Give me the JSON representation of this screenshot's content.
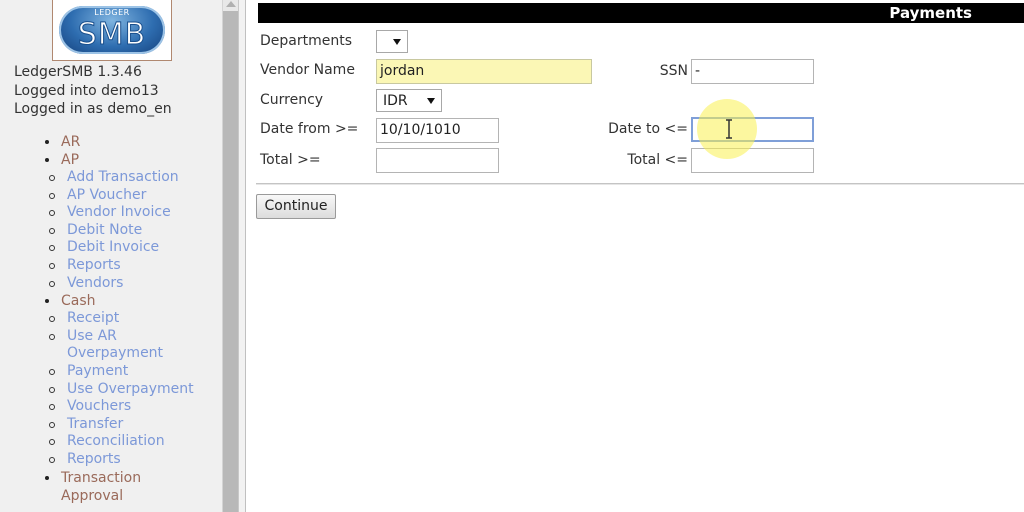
{
  "sidebar": {
    "logo": {
      "top_text": "LEDGER",
      "main_text": "SMB"
    },
    "info": {
      "version": "LedgerSMB 1.3.46",
      "database": "Logged into demo13",
      "user": "Logged in as demo_en"
    },
    "menu": [
      {
        "label": "AR",
        "children": []
      },
      {
        "label": "AP",
        "children": [
          "Add Transaction",
          "AP Voucher",
          "Vendor Invoice",
          "Debit Note",
          "Debit Invoice",
          "Reports",
          "Vendors"
        ]
      },
      {
        "label": "Cash",
        "children": [
          "Receipt",
          "Use AR Overpayment",
          "Payment",
          "Use Overpayment",
          "Vouchers",
          "Transfer",
          "Reconciliation",
          "Reports"
        ]
      },
      {
        "label": "Transaction Approval",
        "children": []
      }
    ]
  },
  "main": {
    "title": "Payments",
    "form": {
      "departments_label": "Departments",
      "departments_value": "",
      "vendor_name_label": "Vendor Name",
      "vendor_name_value": "jordan",
      "ssn_label": "SSN",
      "ssn_value": "-",
      "currency_label": "Currency",
      "currency_value": "IDR",
      "date_from_label": "Date from >=",
      "date_from_value": "10/10/1010",
      "date_to_label": "Date to <=",
      "date_to_value": "",
      "total_min_label": "Total >=",
      "total_min_value": "",
      "total_max_label": "Total <=",
      "total_max_value": ""
    },
    "continue_label": "Continue"
  },
  "colors": {
    "menu_top_level": "#9a6a5a",
    "menu_link": "#7c98d8",
    "highlight_field": "#fbf7b5",
    "title_bar": "#000000"
  }
}
